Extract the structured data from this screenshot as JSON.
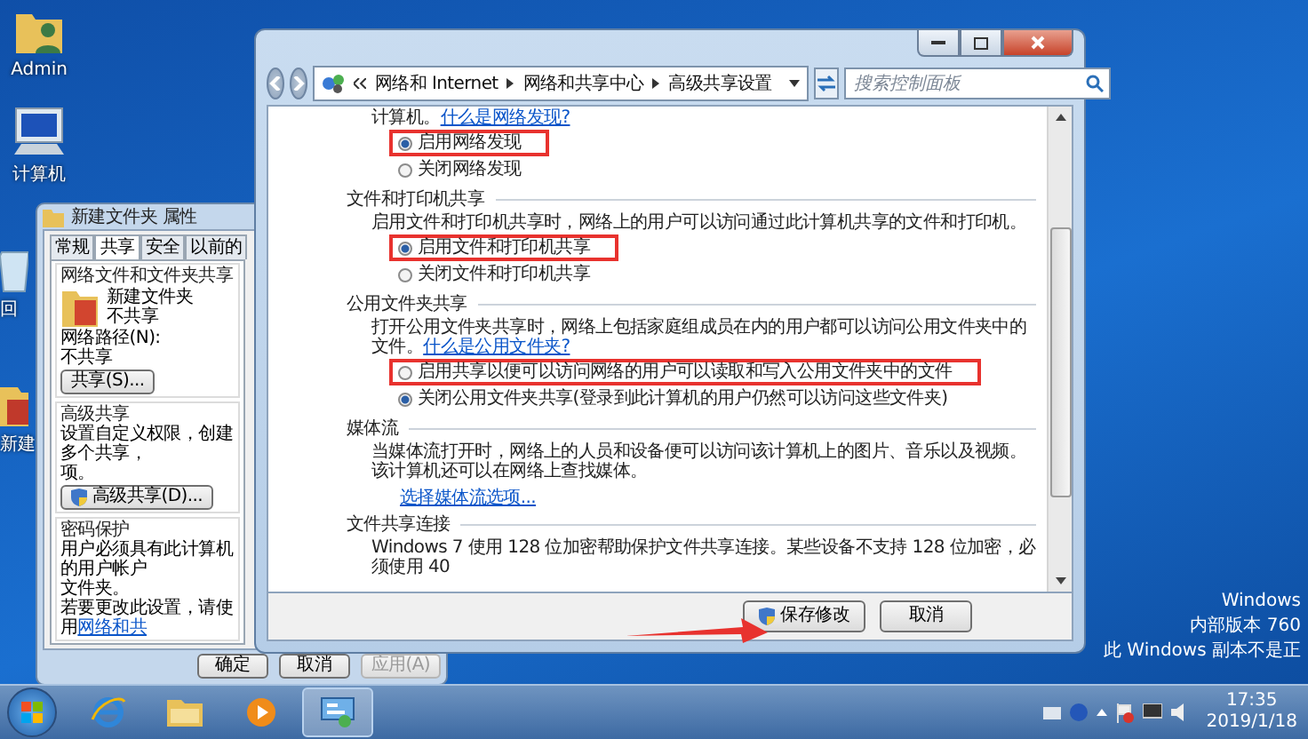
{
  "desktop_icons": [
    {
      "kind": "user",
      "label": "Admin"
    },
    {
      "kind": "computer",
      "label": "计算机"
    },
    {
      "kind": "recycle-bin",
      "label": "回"
    },
    {
      "kind": "folder",
      "label": "新建"
    }
  ],
  "properties_dialog": {
    "title": "新建文件夹 属性",
    "tabs": [
      {
        "label": "常规",
        "selected": false
      },
      {
        "label": "共享",
        "selected": true
      },
      {
        "label": "安全",
        "selected": false
      },
      {
        "label": "以前的",
        "selected": false
      }
    ],
    "network_sharing": {
      "heading": "网络文件和文件夹共享",
      "folder_name": "新建文件夹",
      "folder_status": "不共享",
      "path_label": "网络路径(N):",
      "path_value": "不共享",
      "button": "共享(S)..."
    },
    "advanced_sharing": {
      "heading": "高级共享",
      "lines": [
        "设置自定义权限，创建多个共享，",
        "项。"
      ],
      "button": "高级共享(D)..."
    },
    "password_protection": {
      "heading": "密码保护",
      "lines": [
        "用户必须具有此计算机的用户帐户",
        "文件夹。"
      ],
      "change_text": "若要更改此设置，请使用",
      "change_link": "网络和共"
    },
    "buttons": [
      {
        "label": "确定",
        "disabled": false
      },
      {
        "label": "取消",
        "disabled": false
      },
      {
        "label": "应用(A)",
        "disabled": true
      }
    ]
  },
  "main_window": {
    "breadcrumbs": [
      "网络和 Internet",
      "网络和共享中心",
      "高级共享设置"
    ],
    "search": {
      "placeholder": "搜索控制面板"
    },
    "sections": [
      {
        "text": "计算机。",
        "link": "什么是网络发现?",
        "options": [
          {
            "label": "启用网络发现",
            "selected": true,
            "highlighted": true
          },
          {
            "label": "关闭网络发现",
            "selected": false,
            "highlighted": false
          }
        ]
      },
      {
        "heading": "文件和打印机共享",
        "text": "启用文件和打印机共享时，网络上的用户可以访问通过此计算机共享的文件和打印机。",
        "options": [
          {
            "label": "启用文件和打印机共享",
            "selected": true,
            "highlighted": true
          },
          {
            "label": "关闭文件和打印机共享",
            "selected": false,
            "highlighted": false
          }
        ]
      },
      {
        "heading": "公用文件夹共享",
        "text": "打开公用文件夹共享时，网络上包括家庭组成员在内的用户都可以访问公用文件夹中的文件。",
        "link": "什么是公用文件夹?",
        "options": [
          {
            "label": "启用共享以便可以访问网络的用户可以读取和写入公用文件夹中的文件",
            "selected": false,
            "highlighted": true
          },
          {
            "label": "关闭公用文件夹共享(登录到此计算机的用户仍然可以访问这些文件夹)",
            "selected": true,
            "highlighted": false
          }
        ]
      },
      {
        "heading": "媒体流",
        "text": "当媒体流打开时，网络上的人员和设备便可以访问该计算机上的图片、音乐以及视频。该计算机还可以在网络上查找媒体。",
        "action_link": "选择媒体流选项..."
      },
      {
        "heading": "文件共享连接",
        "text": "Windows 7 使用 128 位加密帮助保护文件共享连接。某些设备不支持 128 位加密，必须使用 40"
      }
    ],
    "buttons": [
      {
        "label": "保存修改",
        "kind": "shield"
      },
      {
        "label": "取消",
        "kind": "plain"
      }
    ]
  },
  "activation_notice": [
    "Windows",
    "内部版本 760",
    "此 Windows 副本不是正"
  ],
  "taskbar": {
    "apps": [
      {
        "kind": "browser",
        "selected": false
      },
      {
        "kind": "folder",
        "selected": false
      },
      {
        "kind": "media",
        "selected": false
      },
      {
        "kind": "network",
        "selected": true
      }
    ],
    "time": "17:35",
    "date": "2019/1/18"
  }
}
